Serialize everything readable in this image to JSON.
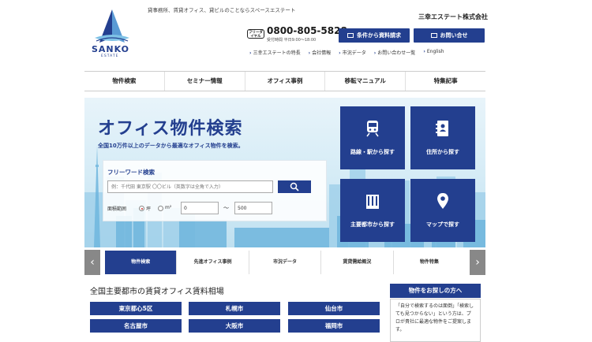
{
  "header": {
    "logo_text": "SANKO",
    "logo_sub": "ESTATE",
    "tagline": "貸事務所、賃貸オフィス、貸ビルのことならスペースエステート",
    "company": "三幸エステート株式会社",
    "free_dial": "フリーダイヤル",
    "phone": "0800-805-5828",
    "hours": "受付時間 平日9:00～18:00",
    "request_button": "条件から資料請求",
    "contact_button": "お問い合せ",
    "sublinks": [
      "三幸エステートの特長",
      "会社情報",
      "市況データ",
      "お問い合わせ一覧",
      "English"
    ]
  },
  "nav": [
    "物件検索",
    "セミナー情報",
    "オフィス事例",
    "移転マニュアル",
    "特集記事"
  ],
  "hero": {
    "title": "オフィス物件検索",
    "subtitle": "全国10万件以上のデータから最適なオフィス物件を検索。",
    "free_word_label": "フリーワード検索",
    "free_word_placeholder": "例：千代田 東京駅 〇〇ビル（英数字は全角で入力）",
    "area_label": "面積範囲",
    "unit_tsubo": "坪",
    "unit_m2": "m²",
    "area_from": "0",
    "tilde": "〜",
    "area_to": "500",
    "tiles": [
      "路線・駅から探す",
      "住所から探す",
      "主要都市から探す",
      "マップで探す"
    ]
  },
  "tabs": [
    "物件検索",
    "先進オフィス事例",
    "市況データ",
    "賃貸需給概況",
    "物件特集"
  ],
  "bottom": {
    "section_title": "全国主要都市の賃貸オフィス賃料相場",
    "cities": [
      "東京都心5区",
      "札幌市",
      "仙台市",
      "名古屋市",
      "大阪市",
      "福岡市"
    ],
    "side_title": "物件をお探しの方へ",
    "side_text": "「自分で検索するのは面倒」「検索しても見つからない」という方は、プロが貴社に最適な物件をご提案します。"
  }
}
